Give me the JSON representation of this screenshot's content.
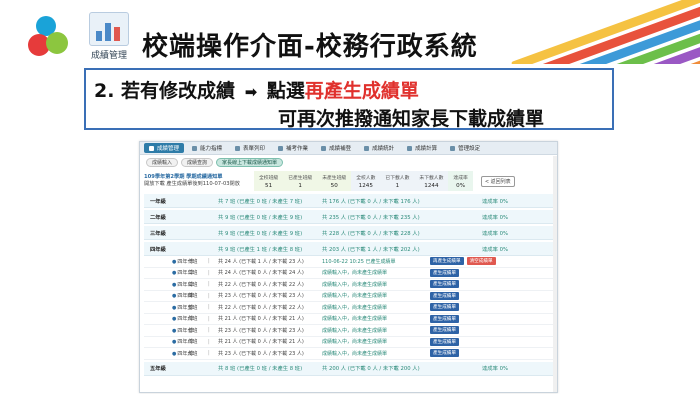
{
  "slide": {
    "logo_caption": "成績管理",
    "title": "校端操作介面-校務行政系統",
    "instruction_prefix": "2. 若有修改成績",
    "instruction_action_pre": "點選",
    "instruction_action_highlight": "再產生成績單",
    "instruction_line2": "可再次推撥通知家長下載成績單",
    "colors": {
      "highlight": "#e0312d",
      "callout_border": "#3a6fb6"
    }
  },
  "app": {
    "nav": [
      {
        "label": "成績管理",
        "icon": "book-icon",
        "active": true
      },
      {
        "label": "能力指標",
        "icon": "target-icon",
        "active": false
      },
      {
        "label": "表單列印",
        "icon": "print-icon",
        "active": false
      },
      {
        "label": "補考作業",
        "icon": "edit-icon",
        "active": false
      },
      {
        "label": "成績補登",
        "icon": "pencil-icon",
        "active": false
      },
      {
        "label": "成績統計",
        "icon": "chart-icon",
        "active": false
      },
      {
        "label": "成績計算",
        "icon": "calculator-icon",
        "active": false
      },
      {
        "label": "管理設定",
        "icon": "gear-icon",
        "active": false
      }
    ],
    "subtabs": [
      {
        "label": "成績輸入",
        "active": false
      },
      {
        "label": "成績查詢",
        "active": false
      },
      {
        "label": "家長線上下載成績通知單",
        "active": true
      }
    ],
    "summary": {
      "term": "109學年第2學期 學期成績通知單",
      "deadline": "開放下載 產生成績單後到110-07-03閉放",
      "stats": [
        {
          "label": "全校班級",
          "value": "51"
        },
        {
          "label": "已產生班級",
          "value": "1"
        },
        {
          "label": "未產生班級",
          "value": "50"
        },
        {
          "label": "全校人數",
          "value": "1245"
        },
        {
          "label": "已下載人數",
          "value": "1"
        },
        {
          "label": "未下載人數",
          "value": "1244"
        },
        {
          "label": "達成率",
          "value": "0%"
        }
      ],
      "back_label": "< 返回列表"
    },
    "grades_top": [
      {
        "name": "一年級",
        "classes": "共 7 班 (已產生 0 班 / 未產生 7 班)",
        "students": "共 176 人 (已下載 0 人 / 未下載 176 人)",
        "rate": "達成率 0%"
      },
      {
        "name": "二年級",
        "classes": "共 9 班 (已產生 0 班 / 未產生 9 班)",
        "students": "共 235 人 (已下載 0 人 / 未下載 235 人)",
        "rate": "達成率 0%"
      },
      {
        "name": "三年級",
        "classes": "共 9 班 (已產生 0 班 / 未產生 9 班)",
        "students": "共 228 人 (已下載 0 人 / 未下載 228 人)",
        "rate": "達成率 0%"
      },
      {
        "name": "四年級",
        "classes": "共 9 班 (已產生 1 班 / 未產生 8 班)",
        "students": "共 203 人 (已下載 1 人 / 未下載 202 人)",
        "rate": "達成率 0%"
      }
    ],
    "classes": [
      {
        "name": "四年一班",
        "teacher": "傅",
        "students": "共 24 人 (已下載 1 人 / 未下載 23 人)",
        "status": "110-06-22 10:25 已產生成績單",
        "button": "再產生成績單",
        "clear": "清空成績單"
      },
      {
        "name": "四年二班",
        "teacher": "傅",
        "students": "共 24 人 (已下載 0 人 / 未下載 24 人)",
        "status": "成績輸入中，尚未產生成績單",
        "button": "產生成績單"
      },
      {
        "name": "四年三班",
        "teacher": "傅",
        "students": "共 22 人 (已下載 0 人 / 未下載 22 人)",
        "status": "成績輸入中，尚未產生成績單",
        "button": "產生成績單"
      },
      {
        "name": "四年四班",
        "teacher": "傅",
        "students": "共 23 人 (已下載 0 人 / 未下載 23 人)",
        "status": "成績輸入中，尚未產生成績單",
        "button": "產生成績單"
      },
      {
        "name": "四年五班",
        "teacher": "傅",
        "students": "共 22 人 (已下載 0 人 / 未下載 22 人)",
        "status": "成績輸入中，尚未產生成績單",
        "button": "產生成績單"
      },
      {
        "name": "四年六班",
        "teacher": "傅",
        "students": "共 21 人 (已下載 0 人 / 未下載 21 人)",
        "status": "成績輸入中，尚未產生成績單",
        "button": "產生成績單"
      },
      {
        "name": "四年七班",
        "teacher": "傅",
        "students": "共 23 人 (已下載 0 人 / 未下載 23 人)",
        "status": "成績輸入中，尚未產生成績單",
        "button": "產生成績單"
      },
      {
        "name": "四年八班",
        "teacher": "傅",
        "students": "共 21 人 (已下載 0 人 / 未下載 21 人)",
        "status": "成績輸入中，尚未產生成績單",
        "button": "產生成績單"
      },
      {
        "name": "四年九班",
        "teacher": "傅",
        "students": "共 23 人 (已下載 0 人 / 未下載 23 人)",
        "status": "成績輸入中，尚未產生成績單",
        "button": "產生成績單"
      }
    ],
    "grades_bottom": [
      {
        "name": "五年級",
        "classes": "共 8 班 (已產生 0 班 / 未產生 8 班)",
        "students": "共 200 人 (已下載 0 人 / 未下載 200 人)",
        "rate": "達成率 0%"
      }
    ]
  }
}
